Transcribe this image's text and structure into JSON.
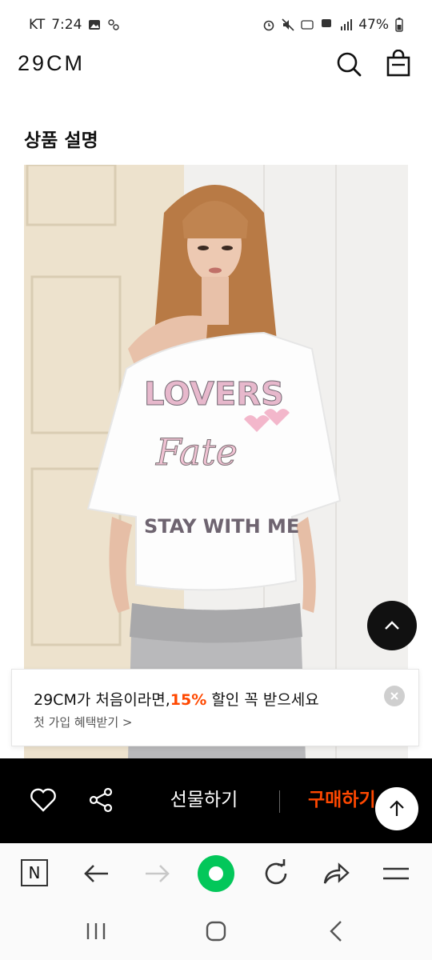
{
  "status_bar": {
    "carrier": "KT",
    "time": "7:24",
    "battery": "47%"
  },
  "header": {
    "logo": "29CM"
  },
  "section": {
    "title": "상품 설명"
  },
  "product_image": {
    "shirt_text_top": "LOVERS",
    "shirt_text_script": "Fate",
    "shirt_text_bottom": "STAY WITH ME"
  },
  "promo": {
    "text_before": "29CM가 처음이라면,",
    "highlight": "15%",
    "text_after": " 할인 꼭 받으세요",
    "sub": "첫 가입 혜택받기 >",
    "highlight_color": "#ff4800"
  },
  "action_bar": {
    "gift_label": "선물하기",
    "buy_label": "구매하기",
    "buy_color": "#ff4800"
  },
  "browser_bar": {
    "home_letter": "N",
    "accent_color": "#03c75a"
  },
  "icons": {
    "header": [
      "search-icon",
      "shopping-bag-icon"
    ],
    "action_bar": [
      "heart-icon",
      "share-icon"
    ],
    "browser_bar": [
      "naver-home-icon",
      "back-arrow-icon",
      "forward-arrow-icon",
      "green-dot-icon",
      "refresh-icon",
      "share-arrow-icon",
      "menu-icon"
    ],
    "system_nav": [
      "recent-apps-icon",
      "home-icon",
      "back-icon"
    ]
  }
}
